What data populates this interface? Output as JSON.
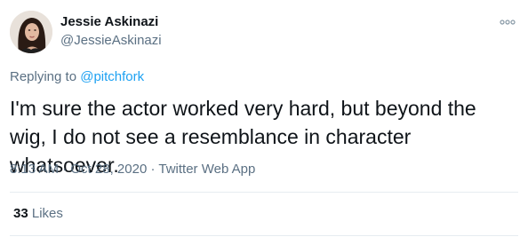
{
  "author": {
    "name": "Jessie Askinazi",
    "handle": "@JessieAskinazi"
  },
  "reply": {
    "prefix": "Replying to",
    "to": "@pitchfork"
  },
  "tweet": {
    "text": "I'm sure the actor worked very hard, but beyond the wig, I do not see a resemblance in character whatsoever.",
    "time": "8:13 AM",
    "date": "Oct 28, 2020",
    "source": "Twitter Web App",
    "separator": "·"
  },
  "stats": {
    "likes_count": "33",
    "likes_label": "Likes"
  },
  "icons": {
    "more": "more-horizontal-icon"
  },
  "colors": {
    "text": "#0f1419",
    "secondary": "#5b7083",
    "link": "#1da1f2",
    "divider": "#e6ecf0"
  }
}
